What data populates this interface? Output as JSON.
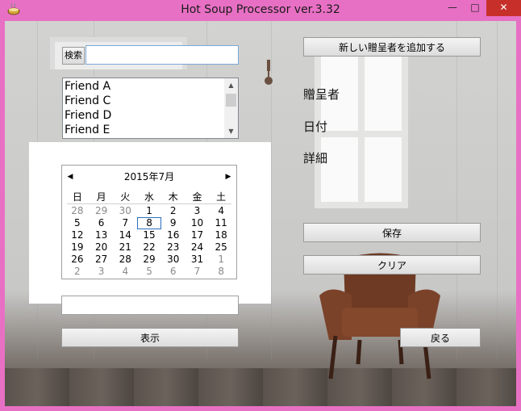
{
  "window": {
    "title": "Hot Soup Processor ver.3.32",
    "minimize": "—",
    "maximize": "□",
    "close": "✕"
  },
  "search": {
    "button_label": "検索",
    "value": ""
  },
  "friends": [
    "Friend A",
    "Friend C",
    "Friend D",
    "Friend E"
  ],
  "calendar": {
    "month_label": "2015年7月",
    "weekdays": [
      "日",
      "月",
      "火",
      "水",
      "木",
      "金",
      "土"
    ],
    "weeks": [
      [
        {
          "d": "28",
          "o": true
        },
        {
          "d": "29",
          "o": true
        },
        {
          "d": "30",
          "o": true
        },
        {
          "d": "1"
        },
        {
          "d": "2"
        },
        {
          "d": "3"
        },
        {
          "d": "4"
        }
      ],
      [
        {
          "d": "5"
        },
        {
          "d": "6"
        },
        {
          "d": "7"
        },
        {
          "d": "8",
          "sel": true
        },
        {
          "d": "9"
        },
        {
          "d": "10"
        },
        {
          "d": "11"
        }
      ],
      [
        {
          "d": "12"
        },
        {
          "d": "13"
        },
        {
          "d": "14"
        },
        {
          "d": "15"
        },
        {
          "d": "16"
        },
        {
          "d": "17"
        },
        {
          "d": "18"
        }
      ],
      [
        {
          "d": "19"
        },
        {
          "d": "20"
        },
        {
          "d": "21"
        },
        {
          "d": "22"
        },
        {
          "d": "23"
        },
        {
          "d": "24"
        },
        {
          "d": "25"
        }
      ],
      [
        {
          "d": "26"
        },
        {
          "d": "27"
        },
        {
          "d": "28"
        },
        {
          "d": "29"
        },
        {
          "d": "30"
        },
        {
          "d": "31"
        },
        {
          "d": "1",
          "o": true
        }
      ],
      [
        {
          "d": "2",
          "o": true
        },
        {
          "d": "3",
          "o": true
        },
        {
          "d": "4",
          "o": true
        },
        {
          "d": "5",
          "o": true
        },
        {
          "d": "6",
          "o": true
        },
        {
          "d": "7",
          "o": true
        },
        {
          "d": "8",
          "o": true
        }
      ]
    ]
  },
  "date_field": {
    "value": ""
  },
  "buttons": {
    "show": "表示",
    "add_giver": "新しい贈呈者を追加する",
    "save": "保存",
    "clear": "クリア",
    "back": "戻る"
  },
  "labels": {
    "giver": "贈呈者",
    "date": "日付",
    "details": "詳細"
  },
  "colors": {
    "titlebar": "#e870c4",
    "close": "#c7302a",
    "selected_day": "#2a6ebb"
  }
}
